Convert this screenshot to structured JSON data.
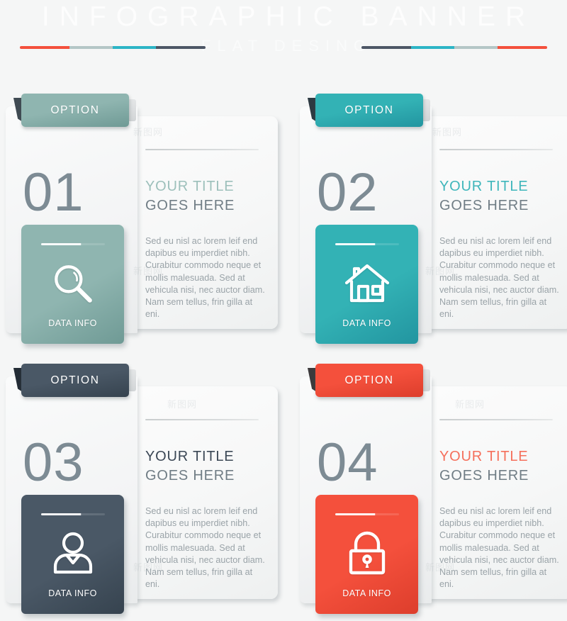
{
  "header": {
    "title": "INFOGRAPHIC BANNER",
    "subtitle": "FLAT DESING",
    "rule_left_colors": [
      "#f4503c",
      "#b4c6c6",
      "#2cb5c6",
      "#4d5766"
    ],
    "rule_right_colors": [
      "#4d5766",
      "#2cb5c6",
      "#b4c6c6",
      "#f4503c"
    ]
  },
  "shared": {
    "option_label": "OPTION",
    "title_main": "YOUR TITLE",
    "title_sub": "GOES HERE",
    "tile_label": "DATA INFO",
    "body": "Sed eu nisl ac lorem leif end dapibus eu imperdiet nibh. Curabitur commodo neque et mollis malesuada. Sed at vehicula nisi, nec auctor diam. Nam sem tellus, frin gilla at eni.",
    "number_color": "#7d8b94",
    "sub_title_color": "#707d85"
  },
  "cards": [
    {
      "number": "01",
      "option_label": "OPTION",
      "title_main": "YOUR TITLE",
      "title_sub": "GOES HERE",
      "tile_label": "DATA INFO",
      "icon": "search-icon",
      "accent": "#8fb5b0",
      "accent_dark": "#6f9a95",
      "tail": "#3f4a52",
      "title_color": "#9dc0bb"
    },
    {
      "number": "02",
      "option_label": "OPTION",
      "title_main": "YOUR TITLE",
      "title_sub": "GOES HERE",
      "tile_label": "DATA INFO",
      "icon": "home-icon",
      "accent": "#33b2b5",
      "accent_dark": "#2295a0",
      "tail": "#2d3a42",
      "title_color": "#3fb6bb"
    },
    {
      "number": "03",
      "option_label": "OPTION",
      "title_main": "YOUR TITLE",
      "title_sub": "GOES HERE",
      "tile_label": "DATA INFO",
      "icon": "user-icon",
      "accent": "#4a5866",
      "accent_dark": "#36434f",
      "tail": "#232c35",
      "title_color": "#3c4856"
    },
    {
      "number": "04",
      "option_label": "OPTION",
      "title_main": "YOUR TITLE",
      "title_sub": "GOES HERE",
      "tile_label": "DATA INFO",
      "icon": "lock-icon",
      "accent": "#f4503c",
      "accent_dark": "#dd3e2c",
      "tail": "#3c3a3c",
      "title_color": "#f5705c"
    }
  ],
  "watermarks": [
    "新图网",
    "新图网",
    "新图网",
    "新图网",
    "新图网",
    "新图网"
  ]
}
